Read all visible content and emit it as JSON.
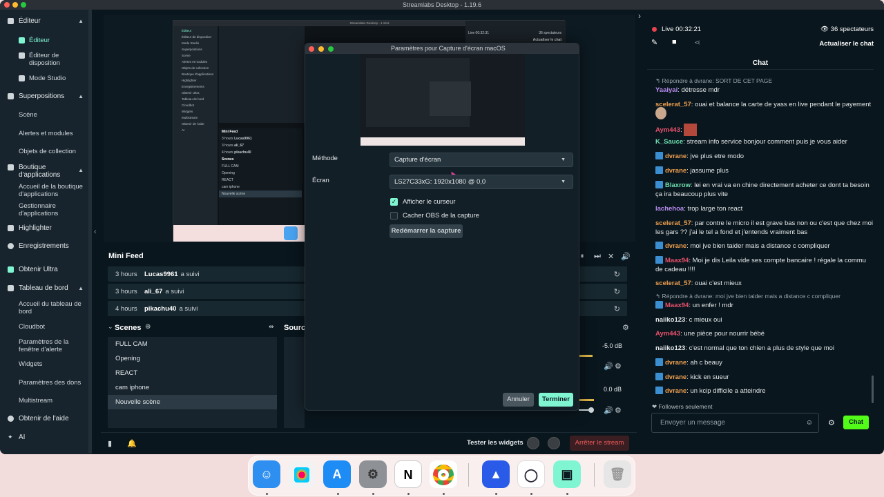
{
  "window": {
    "title": "Streamlabs Desktop - 1.19.6"
  },
  "sidebar": {
    "editor_label": "Éditeur",
    "editor_items": [
      "Éditeur",
      "Éditeur de disposition",
      "Mode Studio"
    ],
    "overlays_label": "Superpositions",
    "overlays_items": [
      "Scène",
      "Alertes et modules",
      "Objets de collection"
    ],
    "appstore_label": "Boutique d'applications",
    "appstore_items": [
      "Accueil de la boutique d'applications",
      "Gestionnaire d'applications"
    ],
    "highlighter": "Highlighter",
    "recordings": "Enregistrements",
    "ultra": "Obtenir Ultra",
    "dashboard_label": "Tableau de bord",
    "dashboard_items": [
      "Accueil du tableau de bord",
      "Cloudbot",
      "Paramètres de la fenêtre d'alerte",
      "Widgets",
      "Paramètres des dons",
      "Multistream"
    ],
    "help": "Obtenir de l'aide",
    "ai": "AI"
  },
  "minifeed": {
    "title": "Mini Feed",
    "rows": [
      {
        "time": "3 hours",
        "user": "Lucas9961",
        "action": "a suivi"
      },
      {
        "time": "3 hours",
        "user": "ali_67",
        "action": "a suivi"
      },
      {
        "time": "4 hours",
        "user": "pikachu40",
        "action": "a suivi"
      }
    ]
  },
  "scenes": {
    "title": "Scenes",
    "items": [
      "FULL CAM",
      "Opening",
      "REACT",
      "cam iphone",
      "Nouvelle scène"
    ],
    "selected": "Nouvelle scène"
  },
  "sources": {
    "title": "Sourc"
  },
  "mixer": {
    "db1": "-5.0 dB",
    "db2": "0.0 dB"
  },
  "bottombar": {
    "test_widgets": "Tester les widgets",
    "stop_stream": "Arrêter le stream"
  },
  "dialog": {
    "title": "Paramètres pour Capture d'écran macOS",
    "method_label": "Méthode",
    "method_value": "Capture d'écran",
    "screen_label": "Écran",
    "screen_value": "LS27C33xG: 1920x1080 @ 0,0",
    "show_cursor": "Afficher le curseur",
    "hide_obs": "Cacher OBS de la capture",
    "restart": "Redémarrer la capture",
    "cancel": "Annuler",
    "done": "Terminer"
  },
  "chat": {
    "live_label": "Live",
    "live_time": "00:32:21",
    "viewers": "36 spectateurs",
    "refresh": "Actualiser le chat",
    "header": "Chat",
    "reply1": "Répondre à dvrane: SORT DE CET PAGE",
    "reply2": "Répondre à dvrane: moi jve bien taider mais a distance c compliquer",
    "messages": [
      {
        "user": "Yaaiyai",
        "text": "détresse mdr",
        "color": "#b98cf0"
      },
      {
        "user": "scelerat_57",
        "text": "ouai et balance la carte de yass en live pendant le payement",
        "color": "#f0a050"
      },
      {
        "user": "Aym443",
        "text": "",
        "color": "#e8516c"
      },
      {
        "user": "K_Sauce",
        "text": "stream info service bonjour comment puis je vous aider",
        "color": "#6fe0b0"
      },
      {
        "user": "dvrane",
        "text": "jve plus etre modo",
        "color": "#f0a050"
      },
      {
        "user": "dvrane",
        "text": "jassume plus",
        "color": "#f0a050"
      },
      {
        "user": "Blaxrow",
        "text": "lei en vrai va en chine directement acheter ce dont ta besoin ça ira beaucoup plus vite",
        "color": "#6fe0b0"
      },
      {
        "user": "lachehoa",
        "text": "trop large ton react",
        "color": "#b98cf0"
      },
      {
        "user": "scelerat_57",
        "text": "par contre le micro il est grave bas non ou c'est que chez moi les gars ?? j'ai le tel a fond et j'entends vraiment bas",
        "color": "#f0a050"
      },
      {
        "user": "dvrane",
        "text": "moi jve bien taider mais a distance c compliquer",
        "color": "#f0a050"
      },
      {
        "user": "Maax94",
        "text": "Moi je dis Leila vide ses compte bancaire ! régale la commu de cadeau !!!!",
        "color": "#e8516c"
      },
      {
        "user": "scelerat_57",
        "text": "ouai c'est mieux",
        "color": "#f0a050"
      },
      {
        "user": "Maax94",
        "text": "un enfer ! mdr",
        "color": "#e8516c"
      },
      {
        "user": "naiiko123",
        "text": "c mieux oui",
        "color": "#e4e8ea"
      },
      {
        "user": "Aym443",
        "text": "une pièce pour nourrir bébé",
        "color": "#e8516c"
      },
      {
        "user": "naiiko123",
        "text": "c'est normal que ton chien a plus de style que moi",
        "color": "#e4e8ea"
      },
      {
        "user": "dvrane",
        "text": "ah c beauy",
        "color": "#f0a050"
      },
      {
        "user": "dvrane",
        "text": "kick en sueur",
        "color": "#f0a050"
      },
      {
        "user": "dvrane",
        "text": "un kcip difficile a atteindre",
        "color": "#f0a050"
      }
    ],
    "followers_only": "Followers seulement",
    "input_placeholder": "Envoyer un message",
    "send": "Chat"
  },
  "nested_preview": {
    "title": "Streamlabs Desktop - 1.19.6",
    "live": "Live 00:32:31",
    "viewers": "36 spectateurs",
    "refresh": "Actualiser le chat",
    "minifeed": "Mini Feed",
    "scenes": "Scenes",
    "scene_items": [
      "FULL CAM",
      "Opening",
      "REACT",
      "cam iphone",
      "Nouvelle scène"
    ],
    "side_items": [
      "Éditeur",
      "Éditeur de disposition",
      "Mode Studio",
      "Superpositions",
      "Scène",
      "Alertes et modules",
      "Objets de collection",
      "Boutique d'applications",
      "Highlighter",
      "Enregistrements",
      "Obtenir Ultra",
      "Tableau de bord",
      "Cloudbot",
      "Widgets",
      "Multistream",
      "Obtenir de l'aide",
      "AI"
    ]
  },
  "colors": {
    "accent": "#80f5d2",
    "live_red": "#e8434f",
    "stop_red": "#f05b5b"
  }
}
